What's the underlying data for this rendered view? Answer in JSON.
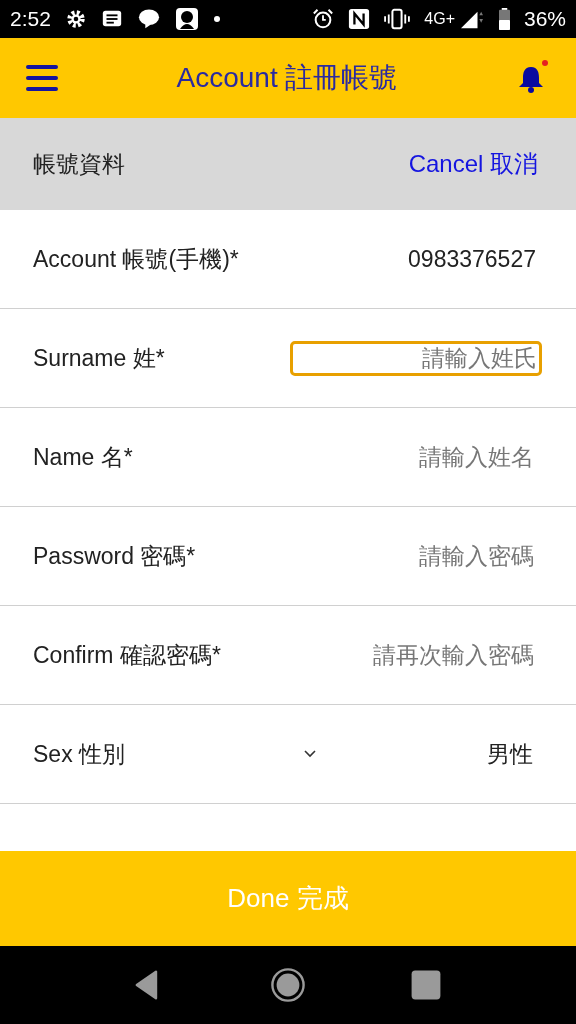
{
  "status_bar": {
    "time": "2:52",
    "network": "4G+",
    "battery": "36%"
  },
  "header": {
    "title": "Account 註冊帳號",
    "notification": true
  },
  "section": {
    "title": "帳號資料",
    "action": "Cancel 取消"
  },
  "fields": [
    {
      "kind": "value",
      "label": "Account 帳號(手機)*",
      "value": "0983376527"
    },
    {
      "kind": "input",
      "label": "Surname 姓*",
      "placeholder": "請輸入姓氏",
      "focused": true
    },
    {
      "kind": "input",
      "label": "Name 名*",
      "placeholder": "請輸入姓名",
      "focused": false
    },
    {
      "kind": "input",
      "label": "Password 密碼*",
      "placeholder": "請輸入密碼",
      "focused": false
    },
    {
      "kind": "input",
      "label": "Confirm 確認密碼*",
      "placeholder": "請再次輸入密碼",
      "focused": false
    },
    {
      "kind": "select",
      "label": "Sex 性別",
      "value": "男性"
    }
  ],
  "done_button": "Done 完成"
}
